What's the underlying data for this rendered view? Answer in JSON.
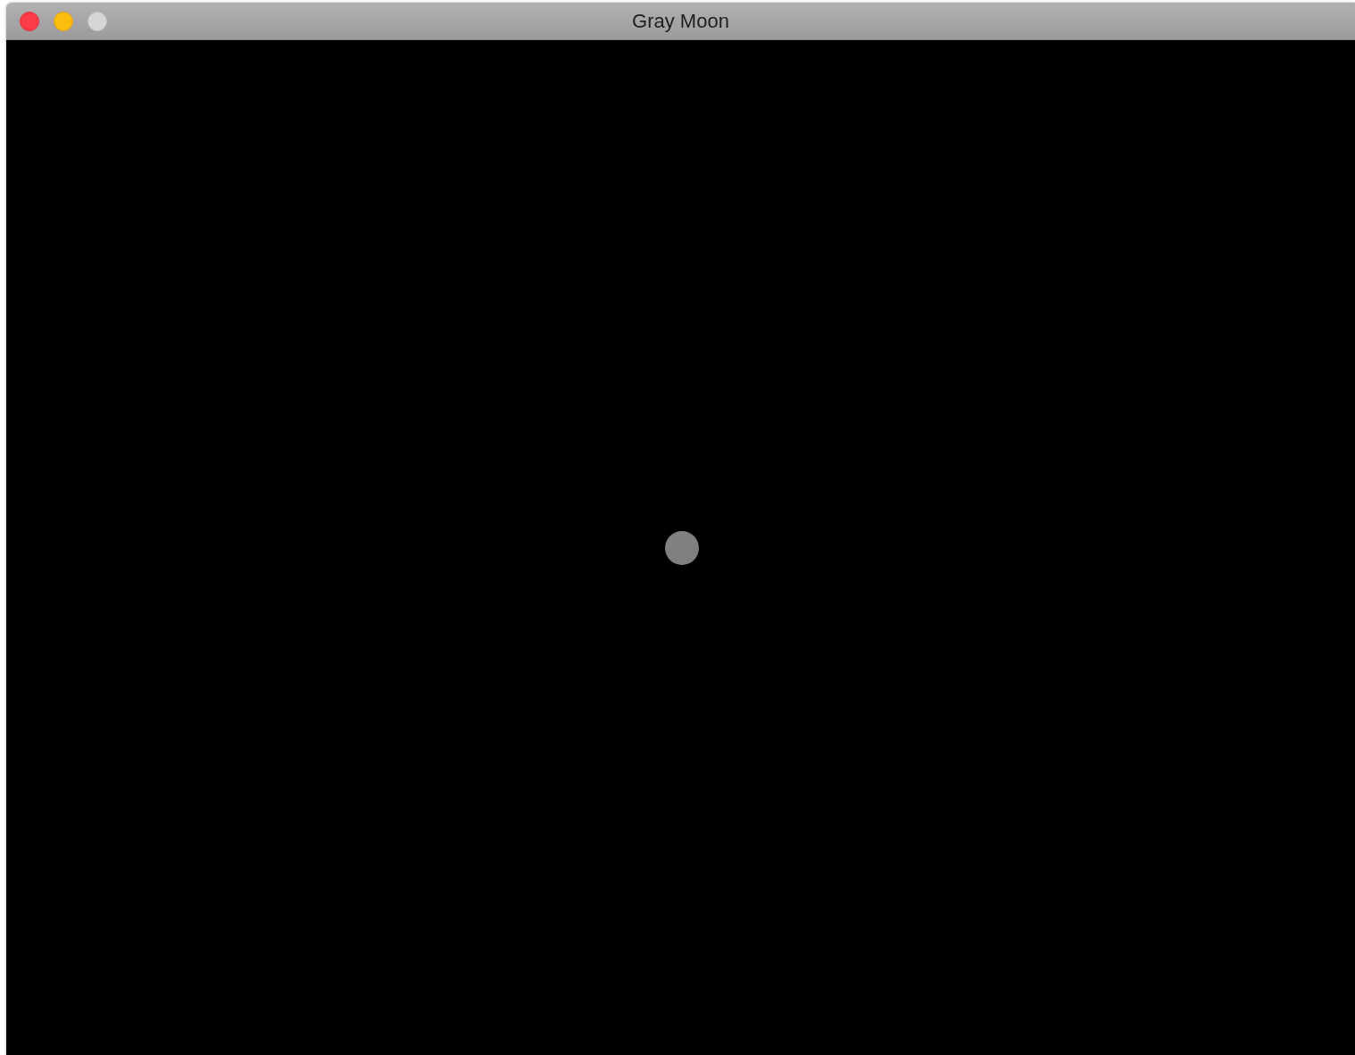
{
  "window": {
    "title": "Gray Moon",
    "buttons": [
      {
        "kind": "close",
        "disabled": false
      },
      {
        "kind": "minimize",
        "disabled": false
      },
      {
        "kind": "zoom",
        "disabled": true
      }
    ]
  },
  "canvas": {
    "shape": {
      "kind": "circle"
    }
  }
}
